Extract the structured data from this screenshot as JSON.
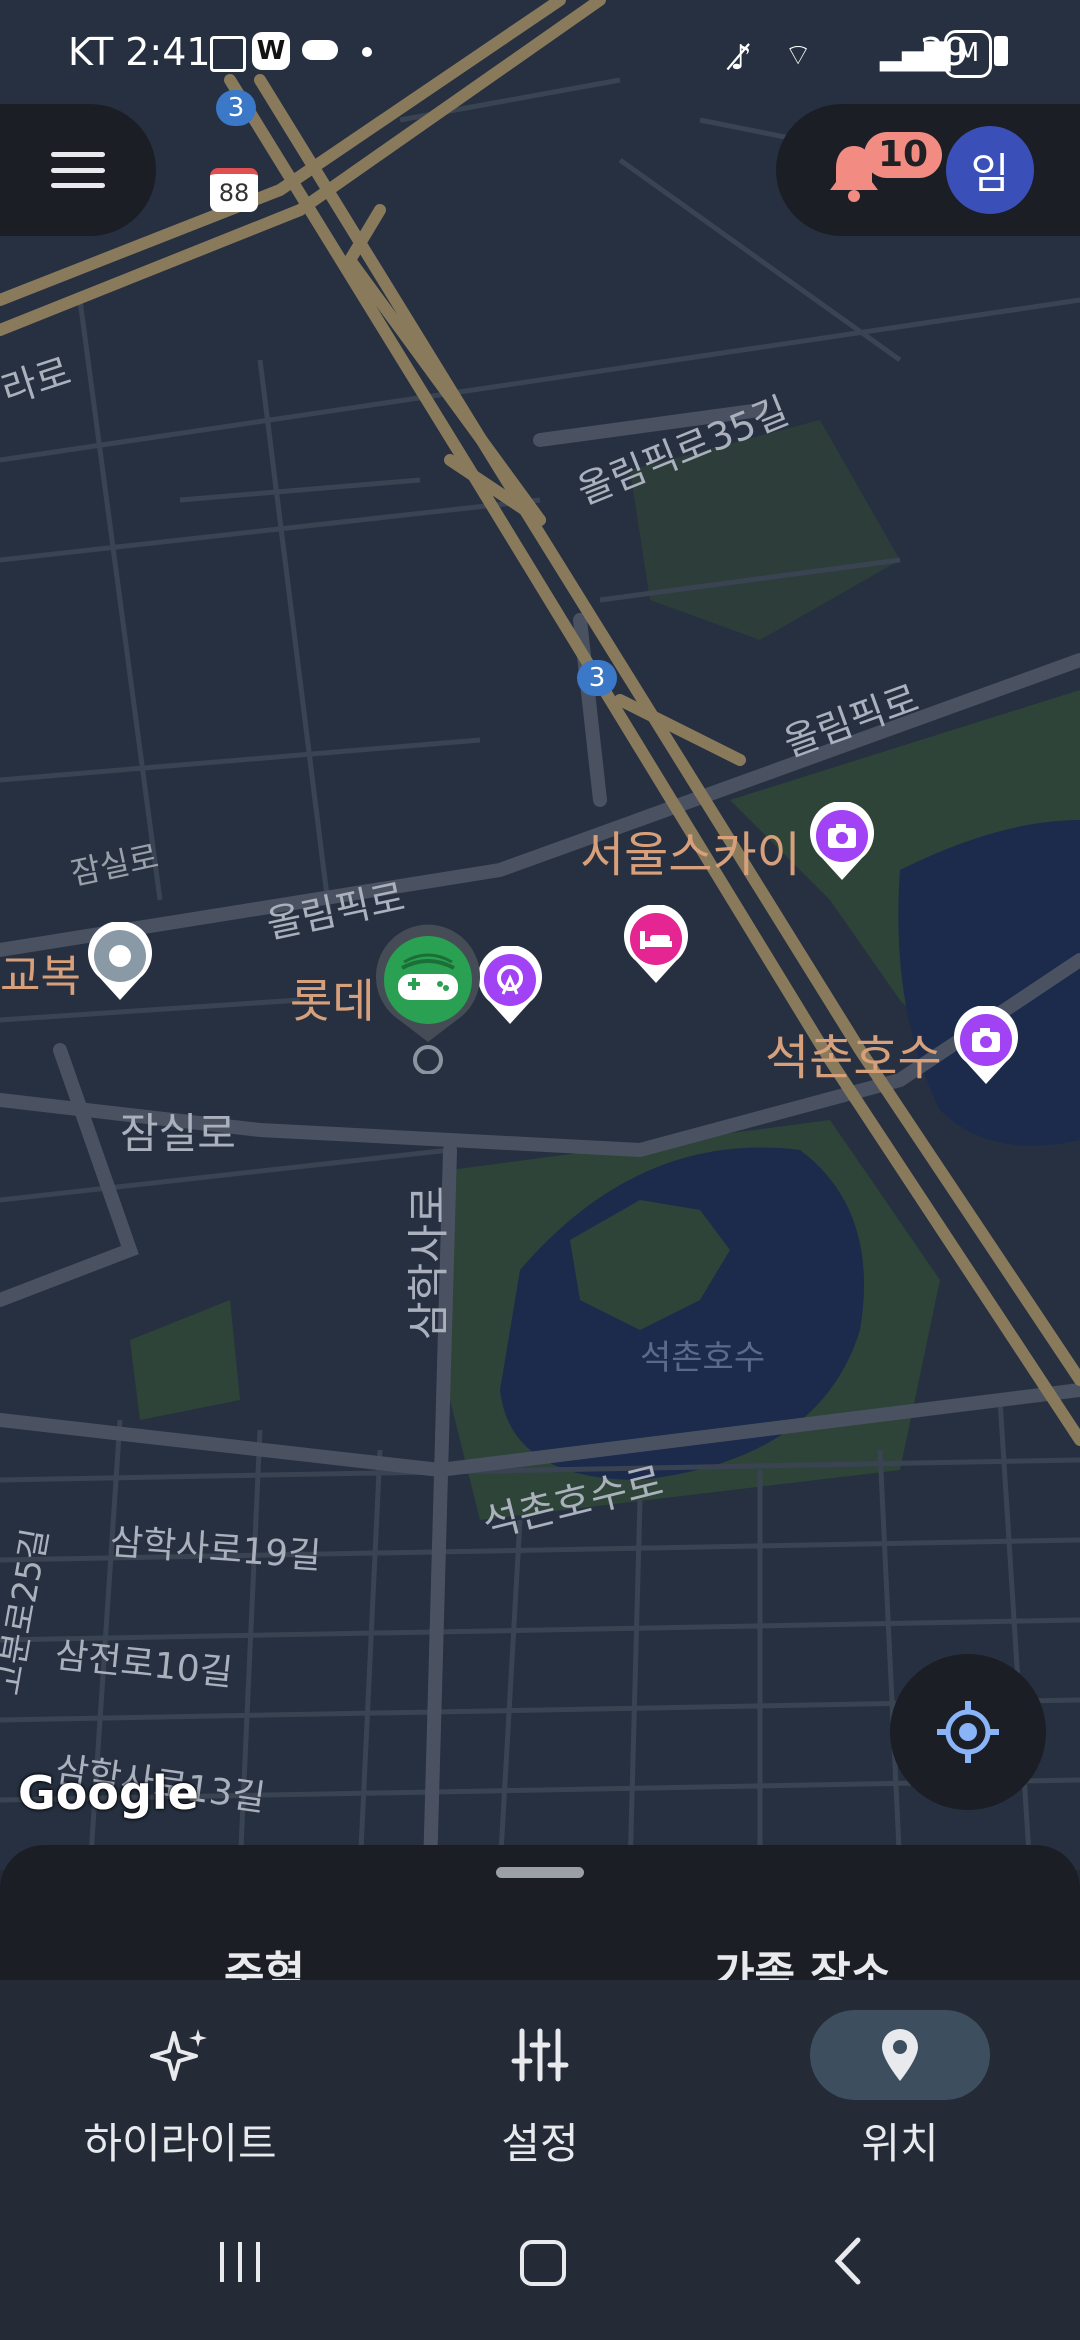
{
  "status_bar": {
    "carrier_time": "KT 2:41",
    "battery": "29"
  },
  "header": {
    "notification_count": "10",
    "avatar_initial": "임"
  },
  "map": {
    "labels": {
      "olympic_35": "올림픽로35길",
      "olympic_right": "올림픽로",
      "olympic_left": "올림픽로",
      "seoul_sky": "서울스카이",
      "lotte": "롯데",
      "seokchon_lake": "석촌호수",
      "jamsil_left": "잠실로",
      "jamsil_center": "잠실로",
      "samhak": "삼학사로",
      "seokchon_lake_water": "석촌호수",
      "seokchon_lake_ro": "석촌호수로",
      "samhak_19": "삼학사로19길",
      "samjeon_10": "삼전로10길",
      "samhak_13": "삼학사로13길",
      "gobun_25": "고분로25길",
      "gyobok": "교복",
      "rarо": "라로",
      "route_3": "3",
      "route_88": "88",
      "route_3b": "3"
    },
    "google_logo": "Google"
  },
  "sheet": {
    "tab_left": "주혁",
    "tab_right": "가족 장소"
  },
  "bottom_nav": {
    "highlights": "하이라이트",
    "settings": "설정",
    "location": "위치"
  },
  "colors": {
    "accent": "#8ab4f8",
    "poi_purple": "#a142f4",
    "poi_pink": "#e52592",
    "road_gold": "#8a7a5c"
  }
}
